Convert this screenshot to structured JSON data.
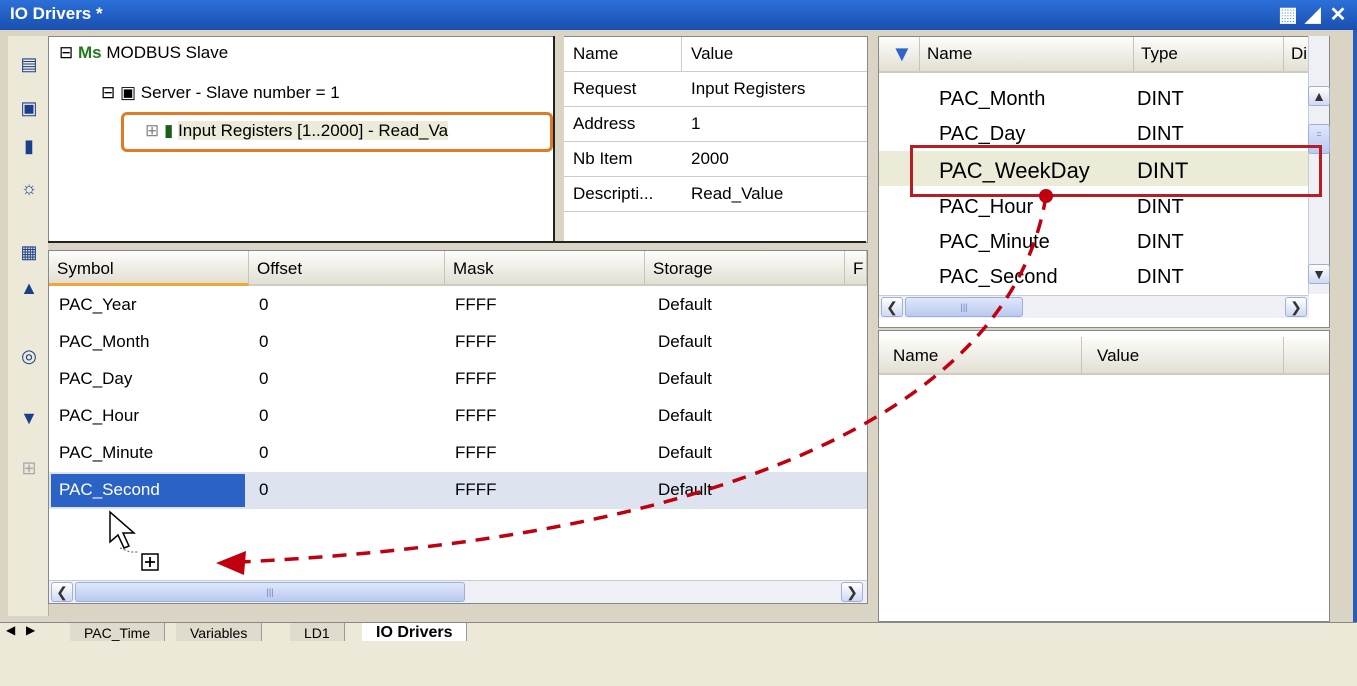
{
  "window": {
    "title": "IO Drivers *"
  },
  "tree": {
    "items": [
      {
        "label": "MODBUS Slave",
        "icon": "Ms"
      },
      {
        "label": "Server - Slave number = 1"
      },
      {
        "label": "Input Registers [1..2000] - Read_Va"
      }
    ]
  },
  "props": {
    "headers": [
      "Name",
      "Value"
    ],
    "rows": [
      [
        "Request",
        "Input Registers"
      ],
      [
        "Address",
        "1"
      ],
      [
        "Nb Item",
        "2000"
      ],
      [
        "Descripti...",
        "Read_Value"
      ]
    ]
  },
  "symgrid": {
    "headers": [
      "Symbol",
      "Offset",
      "Mask",
      "Storage",
      "F"
    ],
    "rows": [
      [
        "PAC_Year",
        "0",
        "FFFF",
        "Default"
      ],
      [
        "PAC_Month",
        "0",
        "FFFF",
        "Default"
      ],
      [
        "PAC_Day",
        "0",
        "FFFF",
        "Default"
      ],
      [
        "PAC_Hour",
        "0",
        "FFFF",
        "Default"
      ],
      [
        "PAC_Minute",
        "0",
        "FFFF",
        "Default"
      ],
      [
        "PAC_Second",
        "0",
        "FFFF",
        "Default"
      ]
    ]
  },
  "vars": {
    "headers": [
      "Name",
      "Type",
      "Dim."
    ],
    "rows": [
      [
        "PAC_Month",
        "DINT"
      ],
      [
        "PAC_Day",
        "DINT"
      ],
      [
        "PAC_WeekDay",
        "DINT"
      ],
      [
        "PAC_Hour",
        "DINT"
      ],
      [
        "PAC_Minute",
        "DINT"
      ],
      [
        "PAC_Second",
        "DINT"
      ]
    ]
  },
  "valpanel": {
    "headers": [
      "Name",
      "Value"
    ]
  },
  "tabs": [
    "PAC_Time",
    "Variables",
    "LD1",
    "IO Drivers"
  ],
  "colors": {
    "highlight": "#c0392b",
    "tree_highlight": "#e07b24",
    "selection": "#2a62c6",
    "arrow": "#c0000f"
  }
}
